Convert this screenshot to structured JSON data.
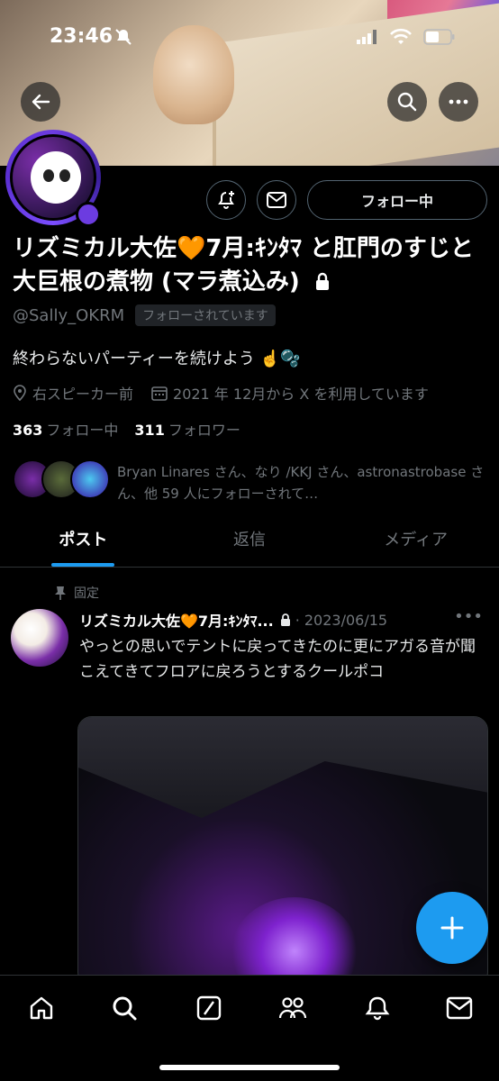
{
  "status_bar": {
    "time": "23:46"
  },
  "profile": {
    "display_name": "リズミカル大佐🧡7月:ｷﾝﾀﾏ と肛門のすじと大巨根の煮物 (マラ煮込み)",
    "handle": "@Sally_OKRM",
    "follows_you": "フォローされています",
    "bio": "終わらないパーティーを続けよう ☝️🫧",
    "location": "右スピーカー前",
    "joined": "2021 年 12月から X を利用しています",
    "following_count": "363",
    "following_label": "フォロー中",
    "followers_count": "311",
    "followers_label": "フォロワー",
    "follow_button": "フォロー中",
    "followed_by_text": "Bryan Linares さん、なり /KKJ さん、astronastrobase さん、他 59 人にフォローされて…"
  },
  "tabs": [
    {
      "label": "ポスト",
      "active": true
    },
    {
      "label": "返信",
      "active": false
    },
    {
      "label": "メディア",
      "active": false
    }
  ],
  "post": {
    "pinned_label": "固定",
    "author": "リズミカル大佐🧡7月:ｷﾝﾀﾏ...",
    "date": "· 2023/06/15",
    "text": "やっとの思いでテントに戻ってきたのに更にアガる音が聞こえてきてフロアに戻ろうとするクールポコ"
  },
  "colors": {
    "accent": "#1d9bf0",
    "avatar_ring": "#6c3ce0",
    "muted": "#71767b"
  },
  "icons": [
    "back-arrow-icon",
    "search-icon",
    "more-icon",
    "bell-plus-icon",
    "mail-icon",
    "location-icon",
    "calendar-icon",
    "pin-icon",
    "lock-icon",
    "plus-icon",
    "home-icon",
    "grok-icon",
    "communities-icon",
    "notifications-icon",
    "messages-icon"
  ]
}
